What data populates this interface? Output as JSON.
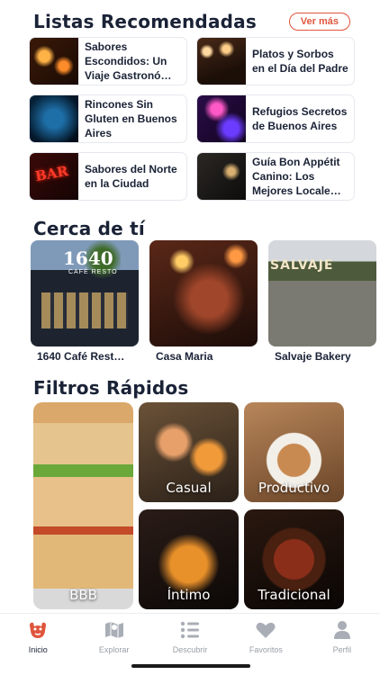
{
  "listas": {
    "title": "Listas Recomendadas",
    "ver_mas": "Ver más",
    "items": [
      {
        "label": "Sabores Escondidos: Un Viaje Gastronó…",
        "thumb": "candlelit-dinner"
      },
      {
        "label": "Platos y Sorbos en el Día del Padre",
        "thumb": "bar-interior"
      },
      {
        "label": "Rincones Sin Gluten en Buenos Aires",
        "thumb": "blue-light"
      },
      {
        "label": "Refugios Secretos de Buenos Aires",
        "thumb": "purple-neon-bar"
      },
      {
        "label": "Sabores del Norte en la Ciudad",
        "thumb": "neon-bar-sign",
        "neon_text": "BAR"
      },
      {
        "label": "Guía Bon Appétit Canino: Los Mejores Locale…",
        "thumb": "dark-restaurant"
      }
    ]
  },
  "cerca": {
    "title": "Cerca de tí",
    "places": [
      {
        "name": "1640 Café Rest…",
        "sign": "1640",
        "sub": "CAFÉ RESTO"
      },
      {
        "name": "Casa Maria"
      },
      {
        "name": "Salvaje Bakery",
        "sign": "SALVAJE"
      }
    ]
  },
  "filtros": {
    "title": "Filtros Rápidos",
    "items": [
      {
        "label": "BBB"
      },
      {
        "label": "Casual"
      },
      {
        "label": "Productivo"
      },
      {
        "label": "Íntimo"
      },
      {
        "label": "Tradicional"
      }
    ]
  },
  "tabbar": {
    "active_color": "#e0553d",
    "inactive_color": "#9aa0a8",
    "tabs": [
      {
        "label": "Inicio",
        "icon": "home-logo-icon",
        "active": true
      },
      {
        "label": "Explorar",
        "icon": "map-icon"
      },
      {
        "label": "Descubrir",
        "icon": "list-icon"
      },
      {
        "label": "Favoritos",
        "icon": "heart-icon"
      },
      {
        "label": "Perfil",
        "icon": "person-icon"
      }
    ]
  }
}
